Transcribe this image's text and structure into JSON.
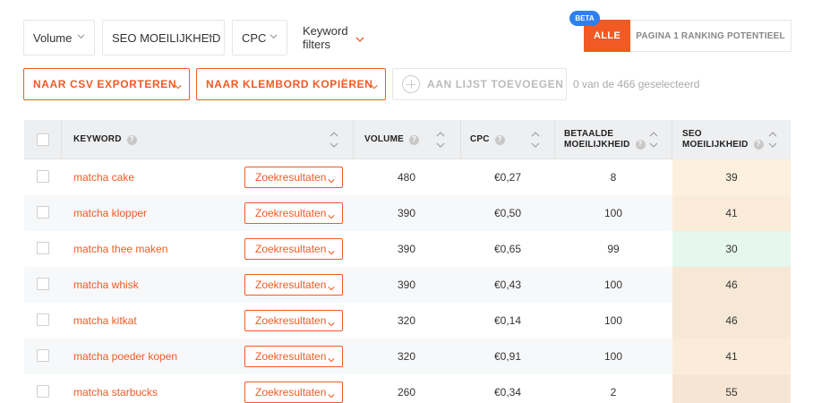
{
  "filters": {
    "volume": "Volume",
    "seo": "SEO MOEILIJKHEID",
    "cpc": "CPC",
    "keyword_filters": "Keyword filters"
  },
  "segment": {
    "beta": "BETA",
    "all": "ALLE",
    "page1": "PAGINA 1 RANKING POTENTIEEL"
  },
  "actions": {
    "csv": "NAAR CSV EXPORTEREN",
    "clipboard": "NAAR KLEMBORD KOPIËREN",
    "add_list": "AAN LIJST TOEVOEGEN",
    "selected": "0 van de 466 geselecteerd"
  },
  "table": {
    "headers": {
      "keyword": "KEYWORD",
      "volume": "VOLUME",
      "cpc": "CPC",
      "paid_1": "BETAALDE",
      "paid_2": "MOEILIJKHEID",
      "seo_1": "SEO",
      "seo_2": "MOEILIJKHEID"
    },
    "serp_label": "Zoekresultaten",
    "rows": [
      {
        "keyword": "matcha cake",
        "volume": "480",
        "cpc": "€0,27",
        "paid": "8",
        "seo": "39",
        "seo_color": "#fdf0dc"
      },
      {
        "keyword": "matcha klopper",
        "volume": "390",
        "cpc": "€0,50",
        "paid": "100",
        "seo": "41",
        "seo_color": "#fbecda"
      },
      {
        "keyword": "matcha thee maken",
        "volume": "390",
        "cpc": "€0,65",
        "paid": "99",
        "seo": "30",
        "seo_color": "#e6f7ee"
      },
      {
        "keyword": "matcha whisk",
        "volume": "390",
        "cpc": "€0,43",
        "paid": "100",
        "seo": "46",
        "seo_color": "#f7e8d6"
      },
      {
        "keyword": "matcha kitkat",
        "volume": "320",
        "cpc": "€0,14",
        "paid": "100",
        "seo": "46",
        "seo_color": "#f7e8d6"
      },
      {
        "keyword": "matcha poeder kopen",
        "volume": "320",
        "cpc": "€0,91",
        "paid": "100",
        "seo": "41",
        "seo_color": "#fbecda"
      },
      {
        "keyword": "matcha starbucks",
        "volume": "260",
        "cpc": "€0,34",
        "paid": "2",
        "seo": "55",
        "seo_color": "#f6e5d2"
      }
    ]
  },
  "colors": {
    "accent": "#f15a24",
    "beta": "#2f80ed"
  }
}
